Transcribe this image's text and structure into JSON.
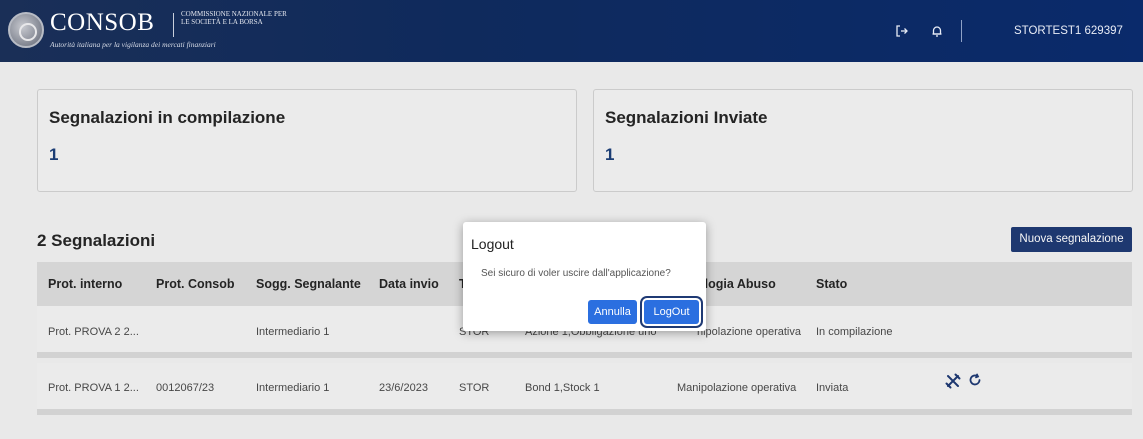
{
  "header": {
    "logo_text": "CONSOB",
    "logo_subtitle": "COMMISSIONE NAZIONALE PER LE SOCIETÀ E LA BORSA",
    "logo_tagline": "Autorità italiana per la vigilanza dei mercati finanziari",
    "logout_icon": "logout-icon",
    "bell_icon": "bell-icon",
    "user": "STORTEST1 629397"
  },
  "cards": [
    {
      "title": "Segnalazioni in compilazione",
      "count": "1"
    },
    {
      "title": "Segnalazioni Inviate",
      "count": "1"
    }
  ],
  "list": {
    "title": "2 Segnalazioni",
    "new_button": "Nuova segnalazione",
    "columns": [
      "Prot. interno",
      "Prot. Consob",
      "Sogg. Segnalante",
      "Data invio",
      "T",
      "",
      "ologia Abuso",
      "Stato"
    ],
    "rows": [
      {
        "prot_interno": "Prot. PROVA 2 2...",
        "prot_consob": "",
        "sogg": "Intermediario 1",
        "data_invio": "",
        "tipo": "STOR",
        "strumenti": "Azione 1,Obbligazione uno",
        "tipologia": "nipolazione operativa",
        "stato": "In compilazione"
      },
      {
        "prot_interno": "Prot. PROVA 1 2...",
        "prot_consob": "0012067/23",
        "sogg": "Intermediario 1",
        "data_invio": "23/6/2023",
        "tipo": "STOR",
        "strumenti": "Bond 1,Stock 1",
        "tipologia": "Manipolazione operativa",
        "stato": "Inviata",
        "actions": [
          "tools-icon",
          "refresh-icon"
        ]
      }
    ]
  },
  "modal": {
    "title": "Logout",
    "message": "Sei sicuro di voler uscire dall'applicazione?",
    "cancel_label": "Annulla",
    "confirm_label": "LogOut"
  },
  "colors": {
    "header_bg": "#0f2a5c",
    "primary_button": "#1f3a74",
    "modal_button": "#2b6fe0",
    "count_text": "#1c3f78",
    "action_icon": "#1f3a74"
  }
}
